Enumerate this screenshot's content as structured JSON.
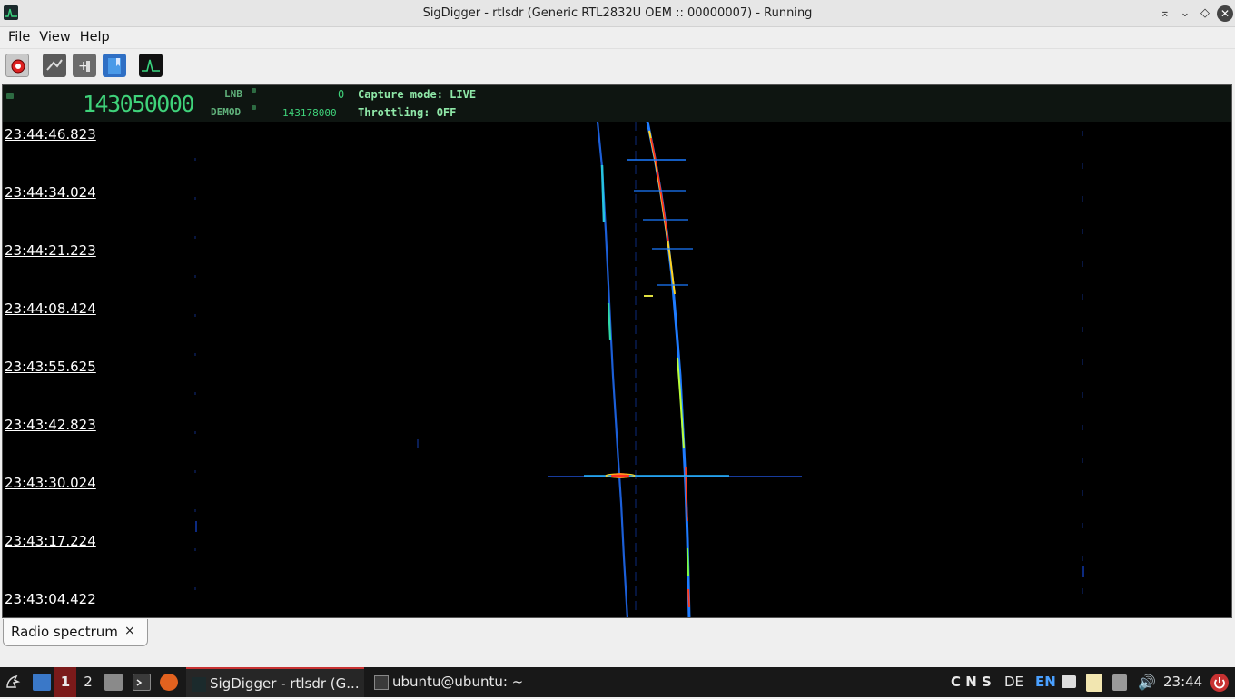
{
  "window": {
    "title": "SigDigger - rtlsdr (Generic RTL2832U OEM :: 00000007) - Running"
  },
  "menu": [
    "File",
    "View",
    "Help"
  ],
  "toolbar": {
    "buttons": [
      "record-stop-icon",
      "settings-icon",
      "add-icon",
      "bookmark-icon",
      "spectrum-icon"
    ]
  },
  "header": {
    "frequency": "143050000",
    "lnb_label": "LNB",
    "lnb_value": "0",
    "demod_label": "DEMOD",
    "demod_value": "143178000",
    "capture_mode": "Capture mode: LIVE",
    "throttling": "Throttling: OFF"
  },
  "waterfall": {
    "timestamps": [
      "23:44:46.823",
      "23:44:34.024",
      "23:44:21.223",
      "23:44:08.424",
      "23:43:55.625",
      "23:43:42.823",
      "23:43:30.024",
      "23:43:17.224",
      "23:43:04.422"
    ]
  },
  "tabs": [
    {
      "label": "Radio spectrum",
      "close": "×"
    }
  ],
  "taskbar": {
    "workspace1": "1",
    "workspace2": "2",
    "task1": "SigDigger - rtlsdr (G...",
    "task2": "ubuntu@ubuntu: ~",
    "tray_cns": "C N S",
    "layout_de": "DE",
    "layout_en": "EN",
    "clock": "23:44"
  },
  "colors": {
    "accent_green": "#3fd27a",
    "waterfall_bg": "#000000",
    "taskbar_bg": "#181818"
  }
}
